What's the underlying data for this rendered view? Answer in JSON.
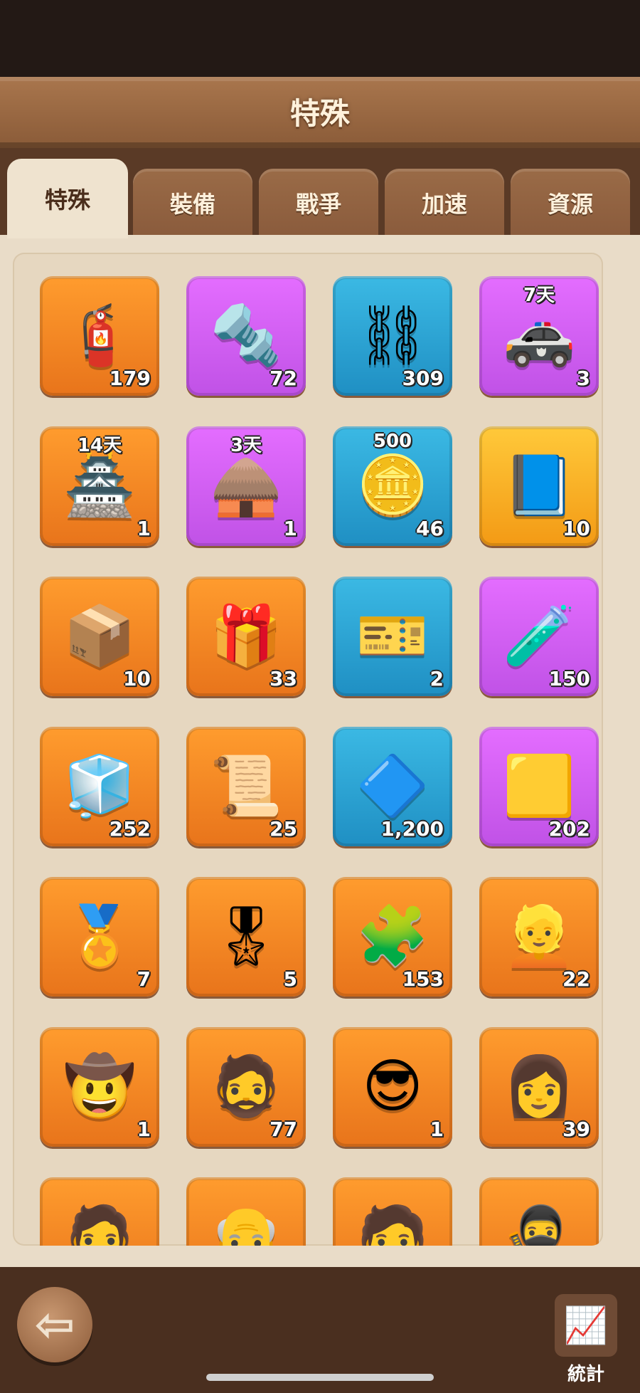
{
  "header": {
    "title": "特殊"
  },
  "tabs": [
    {
      "label": "特殊",
      "active": true
    },
    {
      "label": "裝備"
    },
    {
      "label": "戰爭"
    },
    {
      "label": "加速"
    },
    {
      "label": "資源"
    }
  ],
  "items": [
    {
      "icon_name": "coil-canister-icon",
      "glyph": "🧯",
      "count": "179",
      "badge": "",
      "rarity": "orange"
    },
    {
      "icon_name": "bolt-icon",
      "glyph": "🔩",
      "count": "72",
      "badge": "",
      "rarity": "purple"
    },
    {
      "icon_name": "handcuffs-icon",
      "glyph": "⛓",
      "count": "309",
      "badge": "",
      "rarity": "blue"
    },
    {
      "icon_name": "armored-car-icon",
      "glyph": "🚓",
      "count": "3",
      "badge": "7天",
      "rarity": "purple"
    },
    {
      "icon_name": "tower-skin-icon",
      "glyph": "🏯",
      "count": "1",
      "badge": "14天",
      "rarity": "orange"
    },
    {
      "icon_name": "hut-skin-icon",
      "glyph": "🛖",
      "count": "1",
      "badge": "3天",
      "rarity": "purple"
    },
    {
      "icon_name": "silver-coin-icon",
      "glyph": "🪙",
      "count": "46",
      "badge": "500",
      "rarity": "blue"
    },
    {
      "icon_name": "passport-icon",
      "glyph": "📘",
      "count": "10",
      "badge": "",
      "rarity": "gold"
    },
    {
      "icon_name": "supply-box-icon",
      "glyph": "📦",
      "count": "10",
      "badge": "",
      "rarity": "orange"
    },
    {
      "icon_name": "mystery-crate-icon",
      "glyph": "🎁",
      "count": "33",
      "badge": "",
      "rarity": "orange"
    },
    {
      "icon_name": "exp-ticket-icon",
      "glyph": "🎫",
      "count": "2",
      "badge": "",
      "rarity": "blue"
    },
    {
      "icon_name": "metal-bar-icon",
      "glyph": "🧪",
      "count": "150",
      "badge": "",
      "rarity": "purple"
    },
    {
      "icon_name": "rune-cube-icon",
      "glyph": "🧊",
      "count": "252",
      "badge": "",
      "rarity": "orange"
    },
    {
      "icon_name": "blueprint-scroll-icon",
      "glyph": "📜",
      "count": "25",
      "badge": "",
      "rarity": "orange"
    },
    {
      "icon_name": "crystal-prism-icon",
      "glyph": "🔷",
      "count": "1,200",
      "badge": "",
      "rarity": "blue"
    },
    {
      "icon_name": "gold-cards-icon",
      "glyph": "🟨",
      "count": "202",
      "badge": "",
      "rarity": "purple"
    },
    {
      "icon_name": "hero-medal-icon",
      "glyph": "🏅",
      "count": "7",
      "badge": "",
      "rarity": "orange"
    },
    {
      "icon_name": "heroine-medal-icon",
      "glyph": "🎖",
      "count": "5",
      "badge": "",
      "rarity": "orange"
    },
    {
      "icon_name": "puzzle-piece-icon",
      "glyph": "🧩",
      "count": "153",
      "badge": "",
      "rarity": "orange"
    },
    {
      "icon_name": "hero-shard-blonde-icon",
      "glyph": "👱",
      "count": "22",
      "badge": "",
      "rarity": "orange"
    },
    {
      "icon_name": "hero-shard-cowboy-icon",
      "glyph": "🤠",
      "count": "1",
      "badge": "",
      "rarity": "orange"
    },
    {
      "icon_name": "hero-shard-brute-icon",
      "glyph": "🧔",
      "count": "77",
      "badge": "",
      "rarity": "orange"
    },
    {
      "icon_name": "hero-shard-sunglasses-icon",
      "glyph": "😎",
      "count": "1",
      "badge": "",
      "rarity": "orange"
    },
    {
      "icon_name": "hero-shard-glasses-icon",
      "glyph": "👩",
      "count": "39",
      "badge": "",
      "rarity": "orange"
    },
    {
      "icon_name": "hero-shard-bearded-icon",
      "glyph": "🧔",
      "count": "",
      "badge": "",
      "rarity": "orange"
    },
    {
      "icon_name": "hero-shard-bald-icon",
      "glyph": "👴",
      "count": "",
      "badge": "",
      "rarity": "orange"
    },
    {
      "icon_name": "hero-shard-rogue-icon",
      "glyph": "🧑",
      "count": "",
      "badge": "",
      "rarity": "orange"
    },
    {
      "icon_name": "hero-shard-masked-icon",
      "glyph": "🥷",
      "count": "",
      "badge": "",
      "rarity": "orange"
    }
  ],
  "footer": {
    "back_icon": "back-arrow-icon",
    "stats_icon": "chart-up-icon",
    "stats_label": "統計"
  },
  "colors": {
    "orange": "#f28a25",
    "purple": "#d45ff2",
    "blue": "#2ea6d6",
    "gold": "#f7b125",
    "panel": "#e9dcc8"
  }
}
